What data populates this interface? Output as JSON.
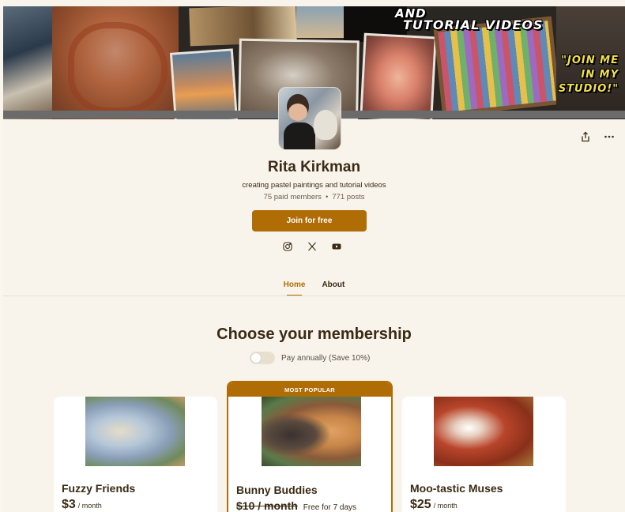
{
  "banner": {
    "headline_1": "AND",
    "headline_2": "TUTORIAL VIDEOS",
    "callout_1": "\"JOIN ME",
    "callout_2": "IN MY",
    "callout_3": "STUDIO!\""
  },
  "creator": {
    "name": "Rita Kirkman",
    "tagline": "creating pastel paintings and tutorial videos",
    "paid_members": "75 paid members",
    "separator": "•",
    "posts": "771 posts"
  },
  "actions": {
    "join_label": "Join for free",
    "share_icon": "share-icon",
    "more_icon": "more-icon"
  },
  "socials": [
    "instagram-icon",
    "x-icon",
    "youtube-icon"
  ],
  "tabs": [
    {
      "label": "Home",
      "active": true
    },
    {
      "label": "About",
      "active": false
    }
  ],
  "membership": {
    "title": "Choose your membership",
    "toggle_label": "Pay annually (Save 10%)"
  },
  "tiers": [
    {
      "name": "Fuzzy Friends",
      "price": "$3",
      "period": "/ month"
    },
    {
      "name": "Bunny Buddies",
      "badge": "MOST POPULAR",
      "price": "$10 / month",
      "trial": "Free for 7 days"
    },
    {
      "name": "Moo-tastic Muses",
      "price": "$25",
      "period": "/ month"
    }
  ],
  "colors": {
    "accent": "#b06d06",
    "background": "#f8f4ec",
    "text": "#3b2a14"
  }
}
